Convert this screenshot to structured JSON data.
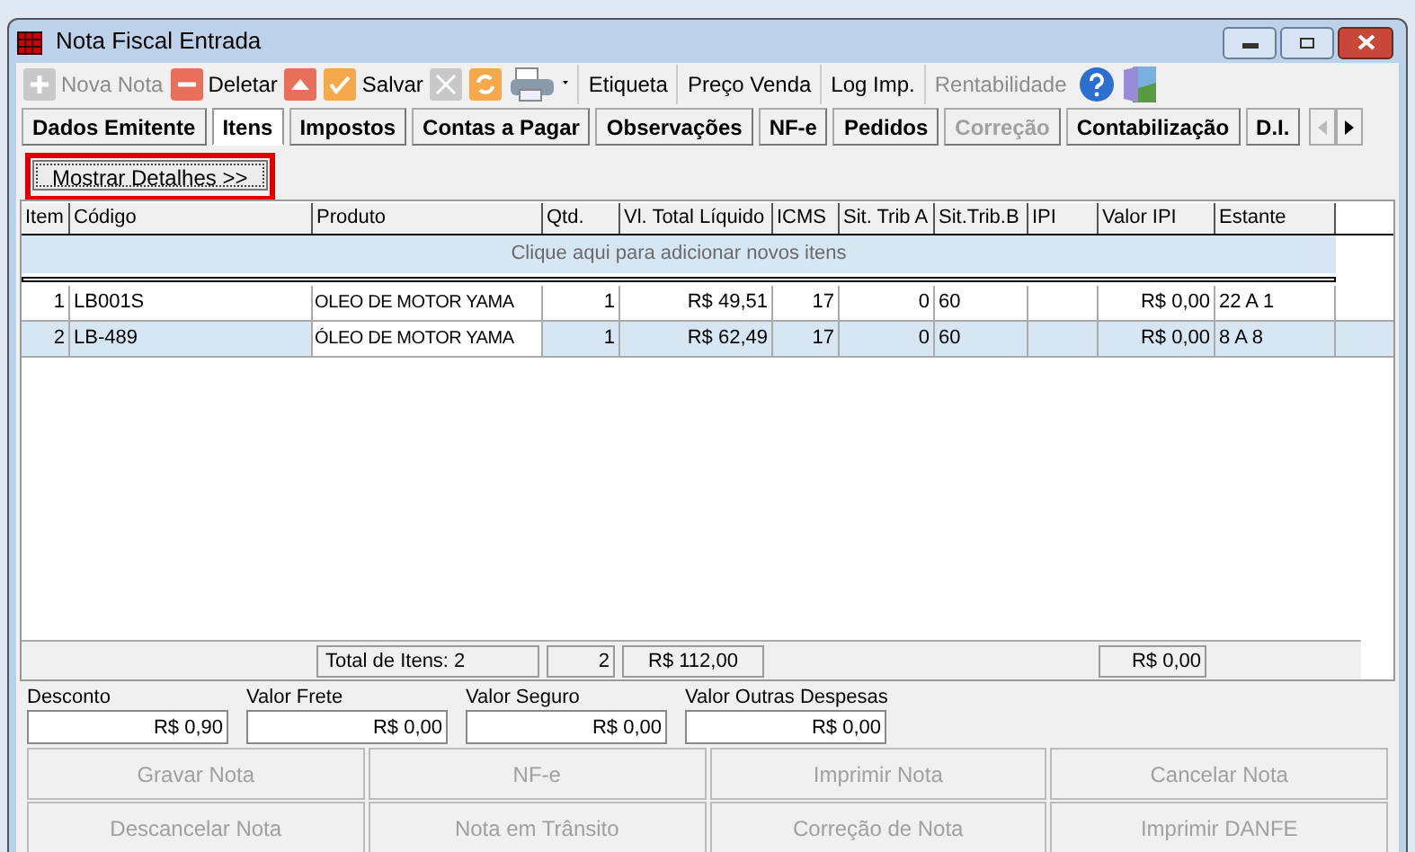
{
  "window": {
    "title": "Nota Fiscal Entrada"
  },
  "toolbar": [
    {
      "kind": "plus",
      "label": "Nova Nota",
      "disabled": true
    },
    {
      "kind": "minus",
      "label": "Deletar",
      "disabled": false
    },
    {
      "kind": "up",
      "disabled": false
    },
    {
      "kind": "check",
      "label": "Salvar",
      "disabled": false
    },
    {
      "kind": "cross",
      "disabled": true
    },
    {
      "kind": "refresh",
      "disabled": false
    },
    {
      "kind": "printer",
      "disabled": false
    },
    {
      "kind": "text",
      "label": "Etiqueta",
      "disabled": false
    },
    {
      "kind": "text",
      "label": "Preço Venda",
      "disabled": false
    },
    {
      "kind": "text",
      "label": "Log Imp.",
      "disabled": false
    },
    {
      "kind": "text",
      "label": "Rentabilidade",
      "disabled": true
    },
    {
      "kind": "help",
      "disabled": false
    },
    {
      "kind": "exit",
      "disabled": false
    }
  ],
  "tabs": [
    {
      "label": "Dados Emitente",
      "selected": false,
      "disabled": false
    },
    {
      "label": "Itens",
      "selected": true,
      "disabled": false
    },
    {
      "label": "Impostos",
      "selected": false,
      "disabled": false
    },
    {
      "label": "Contas a Pagar",
      "selected": false,
      "disabled": false
    },
    {
      "label": "Observações",
      "selected": false,
      "disabled": false
    },
    {
      "label": "NF-e",
      "selected": false,
      "disabled": false
    },
    {
      "label": "Pedidos",
      "selected": false,
      "disabled": false
    },
    {
      "label": "Correção",
      "selected": false,
      "disabled": true
    },
    {
      "label": "Contabilização",
      "selected": false,
      "disabled": false
    },
    {
      "label": "D.I.",
      "selected": false,
      "disabled": false
    }
  ],
  "details_button": "Mostrar Detalhes >>",
  "table": {
    "columns": [
      "Item",
      "Código",
      "Produto",
      "Qtd.",
      "Vl. Total Líquido",
      "ICMS",
      "Sit. Trib A",
      "Sit.Trib.B",
      "IPI",
      "Valor IPI",
      "Estante"
    ],
    "add_row": "Clique aqui para adicionar novos itens",
    "rows": [
      {
        "selected": false,
        "cells": [
          "1",
          "LB001S",
          "OLEO DE MOTOR YAMA",
          "1",
          "R$ 49,51",
          "17",
          "0",
          "60",
          "",
          "R$ 0,00",
          "22 A 1"
        ]
      },
      {
        "selected": true,
        "cells": [
          "2",
          "LB-489",
          "ÓLEO DE MOTOR YAMA",
          "1",
          "R$ 62,49",
          "17",
          "0",
          "60",
          "",
          "R$ 0,00",
          "8 A 8"
        ]
      }
    ],
    "totals": {
      "label": "Total de Itens: 2",
      "qty": "2",
      "total": "R$ 112,00",
      "ipi": "R$ 0,00"
    }
  },
  "fields": [
    {
      "label": "Desconto",
      "value": "R$ 0,90"
    },
    {
      "label": "Valor Frete",
      "value": "R$ 0,00"
    },
    {
      "label": "Valor Seguro",
      "value": "R$ 0,00"
    },
    {
      "label": "Valor Outras Despesas",
      "value": "R$ 0,00"
    }
  ],
  "actions": [
    {
      "label": "Gravar Nota",
      "disabled": true
    },
    {
      "label": "NF-e",
      "disabled": true
    },
    {
      "label": "Imprimir Nota",
      "disabled": true
    },
    {
      "label": "Cancelar Nota",
      "disabled": true
    },
    {
      "label": "Descancelar Nota",
      "disabled": true
    },
    {
      "label": "Nota em Trânsito",
      "disabled": true
    },
    {
      "label": "Correção de Nota",
      "disabled": true
    },
    {
      "label": "Imprimir DANFE",
      "disabled": true
    }
  ]
}
